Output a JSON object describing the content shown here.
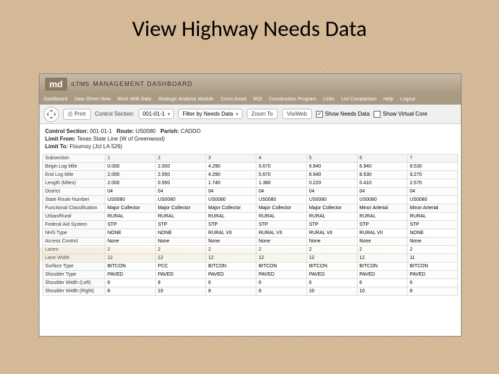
{
  "slide": {
    "title": "View Highway Needs Data"
  },
  "brand": {
    "logo": "md",
    "sub": "d.TIMS",
    "title": "MANAGEMENT DASHBOARD"
  },
  "menu": [
    "Dashboard",
    "Data Sheet View",
    "Work With Data",
    "Strategic Analysis Module",
    "Cross Asset",
    "ROI",
    "Construction Program",
    "Links",
    "List Comparison",
    "Help",
    "Logout"
  ],
  "toolbar": {
    "print": "Print",
    "cs_label": "Control Section:",
    "cs_value": "001-01-1",
    "filter": "Filter by Needs Data",
    "zoom": "Zoom To",
    "visiweb": "VisiWeb",
    "show_needs": "Show Needs Data",
    "show_virtual": "Show Virtual Core"
  },
  "info": {
    "cs_label": "Control Section:",
    "cs_value": "001-01-1",
    "route_label": "Route:",
    "route_value": "US0080",
    "parish_label": "Parish:",
    "parish_value": "CADDO",
    "from_label": "Limit From:",
    "from_value": "Texas State Line (W of Greenwood)",
    "to_label": "Limit To:",
    "to_value": "Flournoy (Jct LA 526)"
  },
  "grid": {
    "header": [
      "Subsection",
      "1",
      "2",
      "3",
      "4",
      "5",
      "6",
      "7"
    ],
    "rows": [
      {
        "label": "Begin Log Mile",
        "cells": [
          "0.000",
          "2.000",
          "4.290",
          "5.670",
          "6.940",
          "6.940",
          "8.530"
        ]
      },
      {
        "label": "End Log Mile",
        "cells": [
          "2.000",
          "2.550",
          "4.290",
          "5.670",
          "6.940",
          "8.530",
          "9.270"
        ]
      },
      {
        "label": "Length (Miles)",
        "cells": [
          "2.000",
          "0.550",
          "1.740",
          "1.380",
          "0.220",
          "0.410",
          "2.570"
        ]
      },
      {
        "label": "District",
        "cells": [
          "04",
          "04",
          "04",
          "04",
          "04",
          "04",
          "04"
        ]
      },
      {
        "label": "State Route Number",
        "cells": [
          "US0080",
          "US0080",
          "US0080",
          "US0080",
          "US0080",
          "US0080",
          "US0080"
        ]
      },
      {
        "label": "Functional Classification",
        "cells": [
          "Major Collector",
          "Major Collector",
          "Major Collector",
          "Major Collector",
          "Major Collector",
          "Minor Arterial",
          "Minor Arterial"
        ]
      },
      {
        "label": "Urban/Rural",
        "cells": [
          "RURAL",
          "RURAL",
          "RURAL",
          "RURAL",
          "RURAL",
          "RURAL",
          "RURAL"
        ]
      },
      {
        "label": "Federal Aid System",
        "cells": [
          "STP",
          "STP",
          "STP",
          "STP",
          "STP",
          "STP",
          "STP"
        ]
      },
      {
        "label": "NHS Type",
        "cells": [
          "NONE",
          "NONE",
          "RURAL VII",
          "RURAL VII",
          "RURAL VII",
          "RURAL VII",
          "NONE"
        ]
      },
      {
        "label": "Access Control",
        "cells": [
          "None",
          "None",
          "None",
          "None",
          "None",
          "None",
          "None"
        ]
      },
      {
        "label": "Lanes",
        "cells": [
          "2",
          "2",
          "2",
          "2",
          "2",
          "2",
          "2"
        ]
      },
      {
        "label": "Lane Width",
        "cells": [
          "12",
          "12",
          "12",
          "12",
          "12",
          "12",
          "11"
        ]
      },
      {
        "label": "Surface Type",
        "cells": [
          "BITCON",
          "PCC",
          "BITCON",
          "BITCON",
          "BITCON",
          "BITCON",
          "BITCON"
        ]
      },
      {
        "label": "Shoulder Type",
        "cells": [
          "PAVED",
          "PAVED",
          "PAVED",
          "PAVED",
          "PAVED",
          "PAVED",
          "PAVED"
        ]
      },
      {
        "label": "Shoulder Width (Left)",
        "cells": [
          "8",
          "8",
          "6",
          "6",
          "6",
          "6",
          "6"
        ]
      },
      {
        "label": "Shoulder Width (Right)",
        "cells": [
          "8",
          "10",
          "8",
          "8",
          "10",
          "10",
          "8"
        ]
      }
    ]
  }
}
